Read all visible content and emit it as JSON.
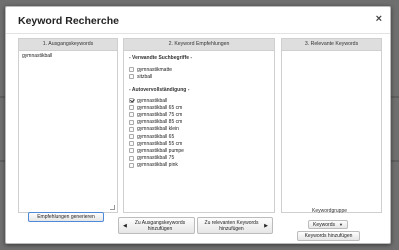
{
  "dialog": {
    "title": "Keyword Recherche",
    "close_icon": "×"
  },
  "columns": {
    "ausgang": {
      "header": "1. Ausgangskeywords",
      "textarea_value": "gymnastikball"
    },
    "empfehlungen": {
      "header": "2. Keyword Empfehlungen",
      "section1_title": "- Verwandte Suchbegriffe -",
      "section1_items": [
        {
          "label": "gymnastikmatte",
          "checked": false
        },
        {
          "label": "sitzball",
          "checked": false
        }
      ],
      "section2_title": "- Autovervollständigung -",
      "section2_items": [
        {
          "label": "gymnastikball",
          "checked": true
        },
        {
          "label": "gymnastikball 65 cm",
          "checked": false
        },
        {
          "label": "gymnastikball 75 cm",
          "checked": false
        },
        {
          "label": "gymnastikball 85 cm",
          "checked": false
        },
        {
          "label": "gymnastikball klein",
          "checked": false
        },
        {
          "label": "gymnastikball 65",
          "checked": false
        },
        {
          "label": "gymnastikball 55 cm",
          "checked": false
        },
        {
          "label": "gymnastikball pumpe",
          "checked": false
        },
        {
          "label": "gymnastikball 75",
          "checked": false
        },
        {
          "label": "gymnastikball pink",
          "checked": false
        }
      ]
    },
    "relevant": {
      "header": "3. Relevante Keywords"
    }
  },
  "buttons": {
    "generate": "Empfehlungen generieren",
    "to_source": [
      "Zu Ausgangskeywords",
      "hinzufügen"
    ],
    "to_relevant": [
      "Zu relevanten Keywords",
      "hinzufügen"
    ],
    "keywords_dropdown": "Keywords",
    "add_keywords": "Keywords hinzufügen"
  },
  "labels": {
    "keyword_group": "Keywordgruppe"
  },
  "colors": {
    "header_bg": "#dedede",
    "accent_border": "#4f8ad8",
    "backdrop": "#6f6f6f"
  }
}
